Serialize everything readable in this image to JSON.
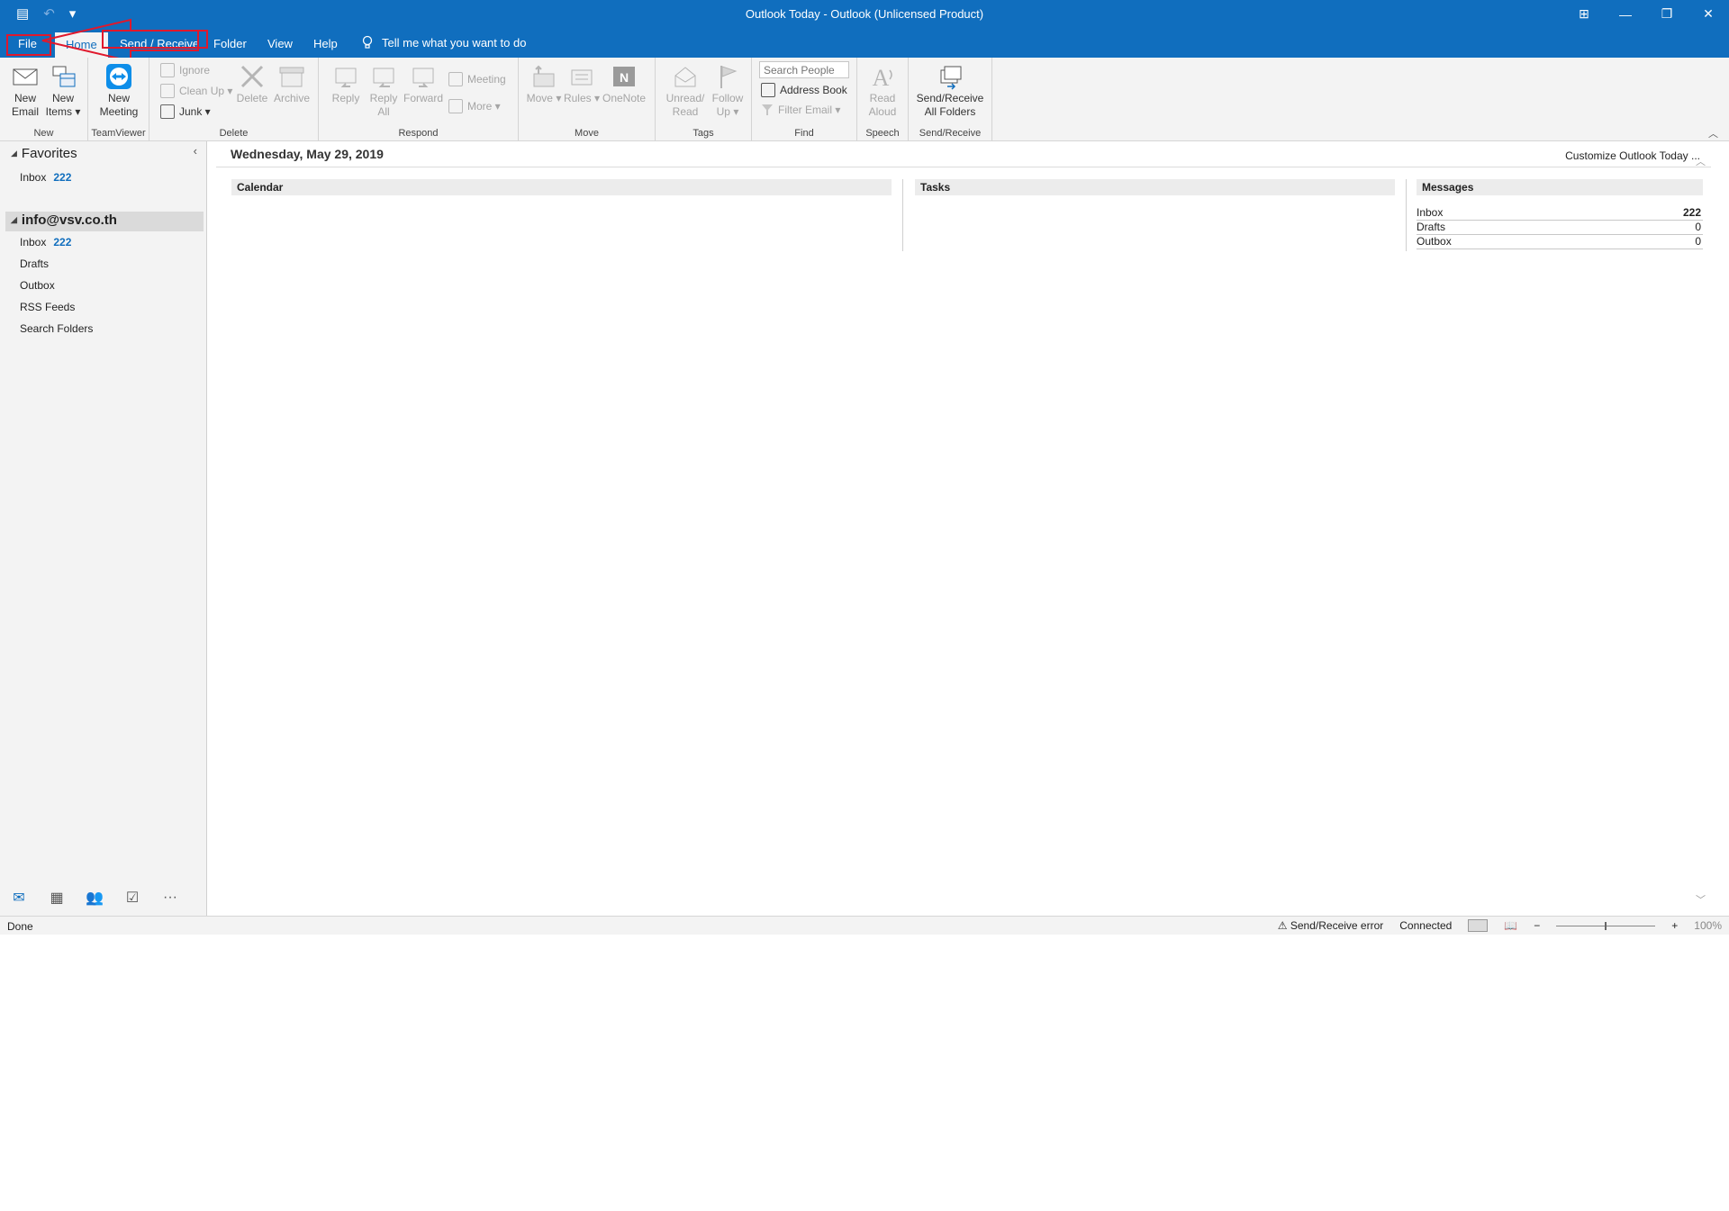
{
  "window": {
    "title": "Outlook Today  -  Outlook (Unlicensed Product)",
    "controls": [
      "⊞",
      "—",
      "❐",
      "✕"
    ]
  },
  "quick_access": {
    "calendar_icon": "▤",
    "undo_icon": "↶",
    "more_icon": "▾"
  },
  "tabs": {
    "file": "File",
    "home": "Home",
    "send_receive": "Send / Receive",
    "folder": "Folder",
    "view": "View",
    "help": "Help",
    "tell_me": "Tell me what you want to do"
  },
  "ribbon": {
    "new_group": {
      "label": "New",
      "new_email": "New Email",
      "new_items": "New Items ▾"
    },
    "teamviewer_group": {
      "label": "TeamViewer",
      "new_meeting": "New Meeting"
    },
    "delete_group": {
      "label": "Delete",
      "ignore": "Ignore",
      "clean_up": "Clean Up ▾",
      "junk": "Junk ▾",
      "delete": "Delete",
      "archive": "Archive"
    },
    "respond_group": {
      "label": "Respond",
      "reply": "Reply",
      "reply_all": "Reply All",
      "forward": "Forward",
      "meeting": "Meeting",
      "more": "More ▾"
    },
    "move_group": {
      "label": "Move",
      "move": "Move ▾",
      "rules": "Rules ▾",
      "onenote": "OneNote"
    },
    "tags_group": {
      "label": "Tags",
      "unread_read": "Unread/ Read",
      "follow_up": "Follow Up ▾"
    },
    "find_group": {
      "label": "Find",
      "search_people": "Search People",
      "address_book": "Address Book",
      "filter_email": "Filter Email ▾"
    },
    "speech_group": {
      "label": "Speech",
      "read_aloud": "Read Aloud"
    },
    "sendreceive_group": {
      "label": "Send/Receive",
      "send_receive_all": "Send/Receive All Folders"
    }
  },
  "folder_pane": {
    "favorites": "Favorites",
    "fav_inbox": {
      "label": "Inbox",
      "count": "222"
    },
    "account": "info@vsv.co.th",
    "folders": [
      {
        "label": "Inbox",
        "count": "222"
      },
      {
        "label": "Drafts"
      },
      {
        "label": "Outbox"
      },
      {
        "label": "RSS Feeds"
      },
      {
        "label": "Search Folders"
      }
    ]
  },
  "main": {
    "date": "Wednesday, May 29, 2019",
    "customize": "Customize Outlook Today ...",
    "calendar": "Calendar",
    "tasks": "Tasks",
    "messages": {
      "title": "Messages",
      "rows": [
        {
          "label": "Inbox",
          "value": "222"
        },
        {
          "label": "Drafts",
          "value": "0"
        },
        {
          "label": "Outbox",
          "value": "0"
        }
      ]
    }
  },
  "status": {
    "left": "Done",
    "error": "Send/Receive error",
    "connection": "Connected",
    "zoom": "100%"
  },
  "colors": {
    "accent": "#106ebe",
    "annotation": "#e0182c"
  }
}
